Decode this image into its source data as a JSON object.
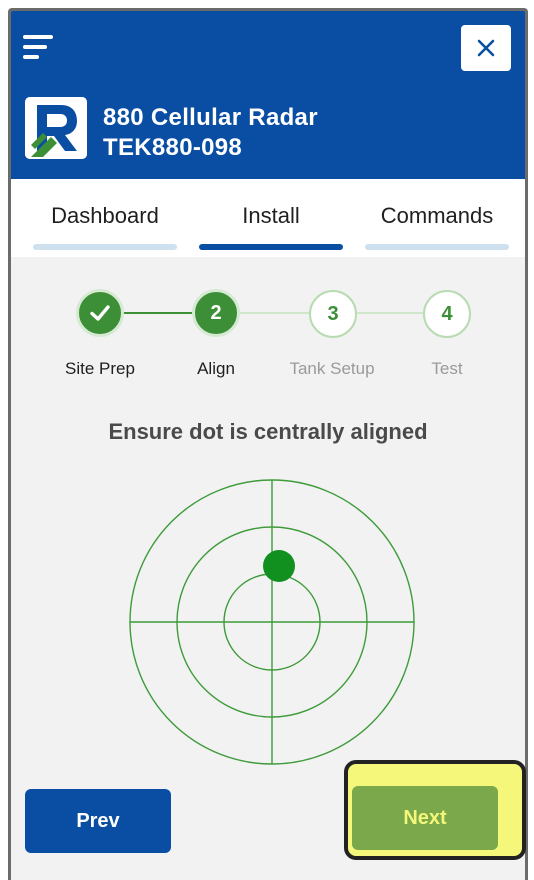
{
  "header": {
    "device_name": "880 Cellular Radar",
    "device_id": "TEK880-098",
    "brand_color": "#0a4ea3",
    "menu_icon": "hamburger-menu-icon",
    "close_icon": "close-icon"
  },
  "tabs": [
    {
      "label": "Dashboard",
      "active": false
    },
    {
      "label": "Install",
      "active": true
    },
    {
      "label": "Commands",
      "active": false
    }
  ],
  "stepper": {
    "steps": [
      {
        "number": "",
        "label": "Site Prep",
        "state": "done"
      },
      {
        "number": "2",
        "label": "Align",
        "state": "current"
      },
      {
        "number": "3",
        "label": "Tank Setup",
        "state": "future"
      },
      {
        "number": "4",
        "label": "Test",
        "state": "future"
      }
    ],
    "accent_color": "#3d8f37"
  },
  "instruction": "Ensure dot is centrally aligned",
  "buttons": {
    "prev_label": "Prev",
    "next_label": "Next"
  }
}
